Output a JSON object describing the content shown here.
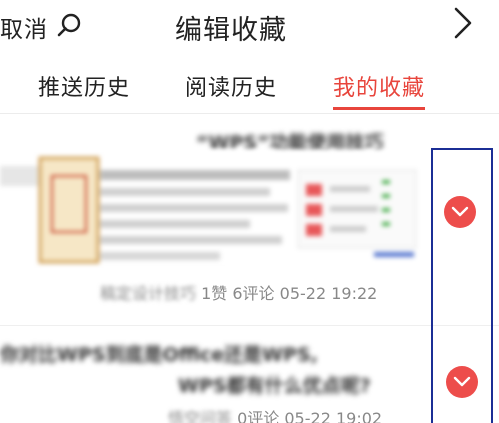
{
  "header": {
    "cancel_label": "取消",
    "title": "编辑收藏"
  },
  "tabs": [
    {
      "label": "推送历史",
      "active": false
    },
    {
      "label": "阅读历史",
      "active": false
    },
    {
      "label": "我的收藏",
      "active": true
    }
  ],
  "articles": [
    {
      "title": "“WPS”功能使用技巧",
      "meta_source": "稿定设计技巧",
      "meta_stats": "1赞 6评论 05-22 19:22"
    },
    {
      "title_line1": "你对比WPS到底是Office还是WPS,",
      "title_line2": "WPS都有什么优点呢?",
      "meta_source": "悟空问答",
      "meta_stats": "0评论 05-22 19:02"
    }
  ],
  "colors": {
    "accent": "#e8453c",
    "dropdown_button": "#ed4d4b",
    "highlight_border": "#1b2e95"
  },
  "icons": {
    "search": "search-icon",
    "back": "chevron-right-icon",
    "dropdown": "chevron-down-icon"
  }
}
